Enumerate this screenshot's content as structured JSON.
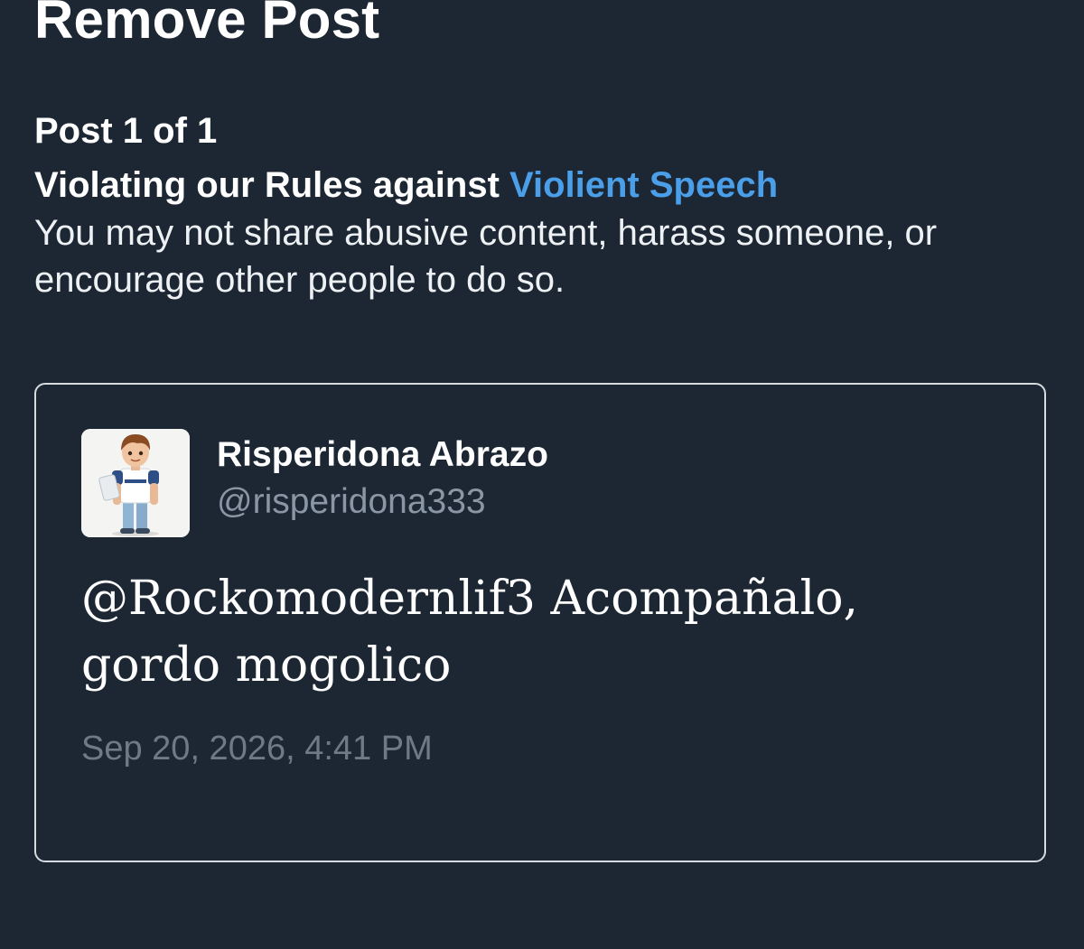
{
  "page": {
    "title": "Remove Post",
    "counter": "Post 1 of 1"
  },
  "violation": {
    "prefix": "Violating our Rules against ",
    "rule_name": "Violient Speech",
    "description": "You may not share abusive content, harass someone, or encourage other people to do so.",
    "link_color": "#4a9fe8"
  },
  "post": {
    "author_name": "Risperidona Abrazo",
    "author_handle": "@risperidona333",
    "avatar_icon": "boy-character-avatar",
    "text_line1": "@Rockomodernlif3 Acompañalo,",
    "text_line2": "gordo mogolico",
    "timestamp": "Sep 20, 2026, 4:41 PM"
  },
  "colors": {
    "background": "#1c2733",
    "card_border": "#d6dbe0",
    "handle": "#8a96a3",
    "timestamp": "#6f7a86"
  }
}
